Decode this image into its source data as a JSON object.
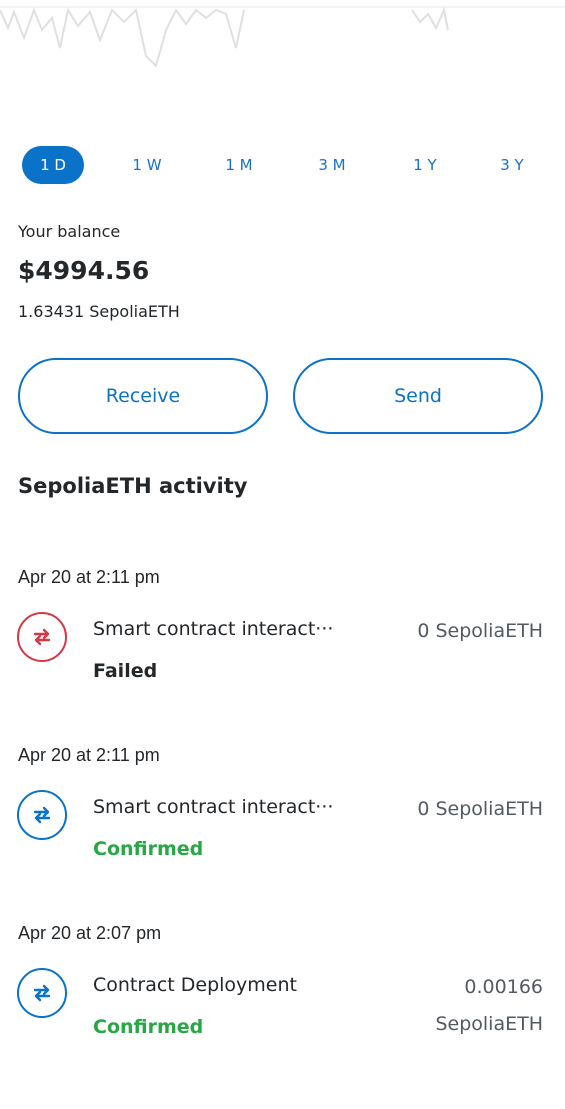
{
  "time_ranges": [
    "1 D",
    "1 W",
    "1 M",
    "3 M",
    "1 Y",
    "3 Y"
  ],
  "selected_range": "1 D",
  "balance": {
    "label": "Your balance",
    "fiat": "$4994.56",
    "token_amount": "1.63431 SepoliaETH"
  },
  "actions": {
    "receive": "Receive",
    "send": "Send"
  },
  "activity": {
    "title": "SepoliaETH activity",
    "items": [
      {
        "date": "Apr 20 at 2:11 pm",
        "title": "Smart contract interact···",
        "status": "Failed",
        "amount_line1": "0 SepoliaETH",
        "amount_line2": "",
        "icon": "swap-arrows-icon",
        "icon_color": "#d73847"
      },
      {
        "date": "Apr 20 at 2:11 pm",
        "title": "Smart contract interact···",
        "status": "Confirmed",
        "amount_line1": "0 SepoliaETH",
        "amount_line2": "",
        "icon": "swap-arrows-icon",
        "icon_color": "#0a72c9"
      },
      {
        "date": "Apr 20 at 2:07 pm",
        "title": "Contract Deployment",
        "status": "Confirmed",
        "amount_line1": "0.00166",
        "amount_line2": "SepoliaETH",
        "icon": "swap-arrows-icon",
        "icon_color": "#0a72c9"
      }
    ]
  },
  "colors": {
    "accent": "#0a72c9",
    "success": "#28a745",
    "error": "#d73847"
  }
}
